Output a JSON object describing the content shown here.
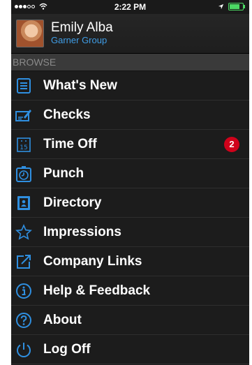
{
  "status_bar": {
    "time": "2:22 PM",
    "signal_icon": "signal-dots-icon",
    "wifi_icon": "wifi-icon",
    "location_icon": "location-arrow-icon",
    "battery_icon": "battery-icon",
    "battery_level": 0.85
  },
  "profile": {
    "name": "Emily Alba",
    "company": "Garner Group"
  },
  "section_header": "BROWSE",
  "menu": {
    "items": [
      {
        "label": "What's New",
        "icon": "news-list-icon"
      },
      {
        "label": "Checks",
        "icon": "checks-icon"
      },
      {
        "label": "Time Off",
        "icon": "calendar-icon",
        "badge": "2"
      },
      {
        "label": "Punch",
        "icon": "stopwatch-icon"
      },
      {
        "label": "Directory",
        "icon": "contact-book-icon"
      },
      {
        "label": "Impressions",
        "icon": "star-icon"
      },
      {
        "label": "Company Links",
        "icon": "external-link-icon"
      },
      {
        "label": "Help & Feedback",
        "icon": "info-icon"
      },
      {
        "label": "About",
        "icon": "question-icon"
      },
      {
        "label": "Log Off",
        "icon": "power-icon"
      }
    ]
  },
  "colors": {
    "icon_blue": "#2f8fe0",
    "badge_red": "#d0021b",
    "company_blue": "#3f9de6",
    "background": "#1c1c1c"
  }
}
